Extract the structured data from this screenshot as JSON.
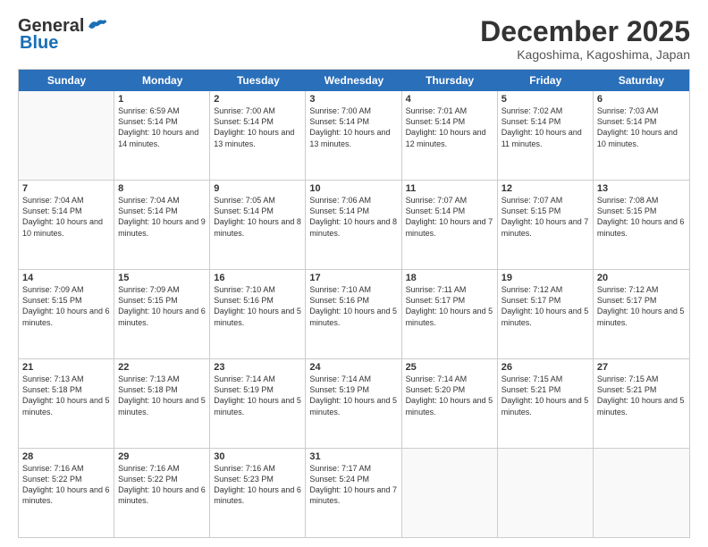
{
  "header": {
    "logo_general": "General",
    "logo_blue": "Blue",
    "month_title": "December 2025",
    "location": "Kagoshima, Kagoshima, Japan"
  },
  "days_of_week": [
    "Sunday",
    "Monday",
    "Tuesday",
    "Wednesday",
    "Thursday",
    "Friday",
    "Saturday"
  ],
  "weeks": [
    [
      {
        "day": "",
        "empty": true
      },
      {
        "day": "1",
        "sunrise": "6:59 AM",
        "sunset": "5:14 PM",
        "daylight": "10 hours and 14 minutes."
      },
      {
        "day": "2",
        "sunrise": "7:00 AM",
        "sunset": "5:14 PM",
        "daylight": "10 hours and 13 minutes."
      },
      {
        "day": "3",
        "sunrise": "7:00 AM",
        "sunset": "5:14 PM",
        "daylight": "10 hours and 13 minutes."
      },
      {
        "day": "4",
        "sunrise": "7:01 AM",
        "sunset": "5:14 PM",
        "daylight": "10 hours and 12 minutes."
      },
      {
        "day": "5",
        "sunrise": "7:02 AM",
        "sunset": "5:14 PM",
        "daylight": "10 hours and 11 minutes."
      },
      {
        "day": "6",
        "sunrise": "7:03 AM",
        "sunset": "5:14 PM",
        "daylight": "10 hours and 10 minutes."
      }
    ],
    [
      {
        "day": "7",
        "sunrise": "7:04 AM",
        "sunset": "5:14 PM",
        "daylight": "10 hours and 10 minutes."
      },
      {
        "day": "8",
        "sunrise": "7:04 AM",
        "sunset": "5:14 PM",
        "daylight": "10 hours and 9 minutes."
      },
      {
        "day": "9",
        "sunrise": "7:05 AM",
        "sunset": "5:14 PM",
        "daylight": "10 hours and 8 minutes."
      },
      {
        "day": "10",
        "sunrise": "7:06 AM",
        "sunset": "5:14 PM",
        "daylight": "10 hours and 8 minutes."
      },
      {
        "day": "11",
        "sunrise": "7:07 AM",
        "sunset": "5:14 PM",
        "daylight": "10 hours and 7 minutes."
      },
      {
        "day": "12",
        "sunrise": "7:07 AM",
        "sunset": "5:15 PM",
        "daylight": "10 hours and 7 minutes."
      },
      {
        "day": "13",
        "sunrise": "7:08 AM",
        "sunset": "5:15 PM",
        "daylight": "10 hours and 6 minutes."
      }
    ],
    [
      {
        "day": "14",
        "sunrise": "7:09 AM",
        "sunset": "5:15 PM",
        "daylight": "10 hours and 6 minutes."
      },
      {
        "day": "15",
        "sunrise": "7:09 AM",
        "sunset": "5:15 PM",
        "daylight": "10 hours and 6 minutes."
      },
      {
        "day": "16",
        "sunrise": "7:10 AM",
        "sunset": "5:16 PM",
        "daylight": "10 hours and 5 minutes."
      },
      {
        "day": "17",
        "sunrise": "7:10 AM",
        "sunset": "5:16 PM",
        "daylight": "10 hours and 5 minutes."
      },
      {
        "day": "18",
        "sunrise": "7:11 AM",
        "sunset": "5:17 PM",
        "daylight": "10 hours and 5 minutes."
      },
      {
        "day": "19",
        "sunrise": "7:12 AM",
        "sunset": "5:17 PM",
        "daylight": "10 hours and 5 minutes."
      },
      {
        "day": "20",
        "sunrise": "7:12 AM",
        "sunset": "5:17 PM",
        "daylight": "10 hours and 5 minutes."
      }
    ],
    [
      {
        "day": "21",
        "sunrise": "7:13 AM",
        "sunset": "5:18 PM",
        "daylight": "10 hours and 5 minutes."
      },
      {
        "day": "22",
        "sunrise": "7:13 AM",
        "sunset": "5:18 PM",
        "daylight": "10 hours and 5 minutes."
      },
      {
        "day": "23",
        "sunrise": "7:14 AM",
        "sunset": "5:19 PM",
        "daylight": "10 hours and 5 minutes."
      },
      {
        "day": "24",
        "sunrise": "7:14 AM",
        "sunset": "5:19 PM",
        "daylight": "10 hours and 5 minutes."
      },
      {
        "day": "25",
        "sunrise": "7:14 AM",
        "sunset": "5:20 PM",
        "daylight": "10 hours and 5 minutes."
      },
      {
        "day": "26",
        "sunrise": "7:15 AM",
        "sunset": "5:21 PM",
        "daylight": "10 hours and 5 minutes."
      },
      {
        "day": "27",
        "sunrise": "7:15 AM",
        "sunset": "5:21 PM",
        "daylight": "10 hours and 5 minutes."
      }
    ],
    [
      {
        "day": "28",
        "sunrise": "7:16 AM",
        "sunset": "5:22 PM",
        "daylight": "10 hours and 6 minutes."
      },
      {
        "day": "29",
        "sunrise": "7:16 AM",
        "sunset": "5:22 PM",
        "daylight": "10 hours and 6 minutes."
      },
      {
        "day": "30",
        "sunrise": "7:16 AM",
        "sunset": "5:23 PM",
        "daylight": "10 hours and 6 minutes."
      },
      {
        "day": "31",
        "sunrise": "7:17 AM",
        "sunset": "5:24 PM",
        "daylight": "10 hours and 7 minutes."
      },
      {
        "day": "",
        "empty": true
      },
      {
        "day": "",
        "empty": true
      },
      {
        "day": "",
        "empty": true
      }
    ]
  ],
  "labels": {
    "sunrise_prefix": "Sunrise: ",
    "sunset_prefix": "Sunset: ",
    "daylight_prefix": "Daylight: "
  }
}
